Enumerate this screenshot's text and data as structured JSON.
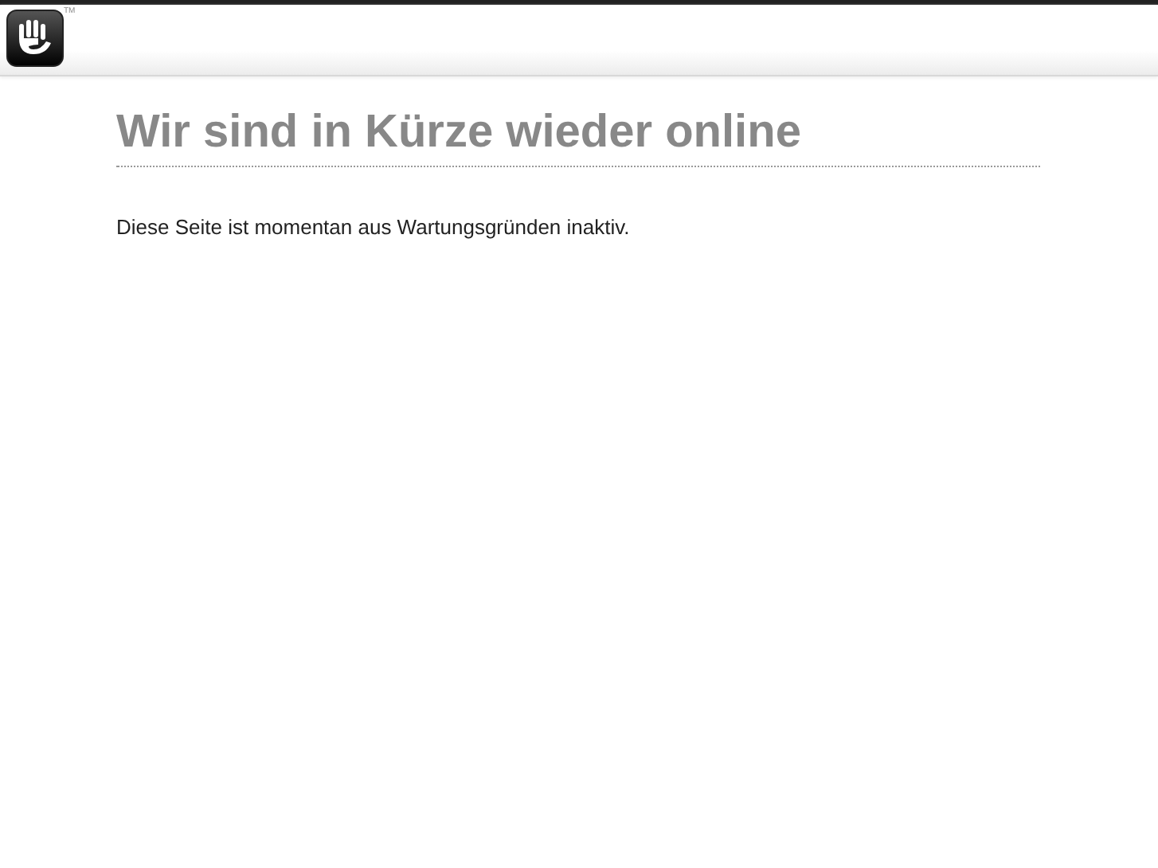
{
  "header": {
    "logo_mark": "TM"
  },
  "main": {
    "title": "Wir sind in Kürze wieder online",
    "message": "Diese Seite ist momentan aus Wartungsgründen inaktiv."
  }
}
